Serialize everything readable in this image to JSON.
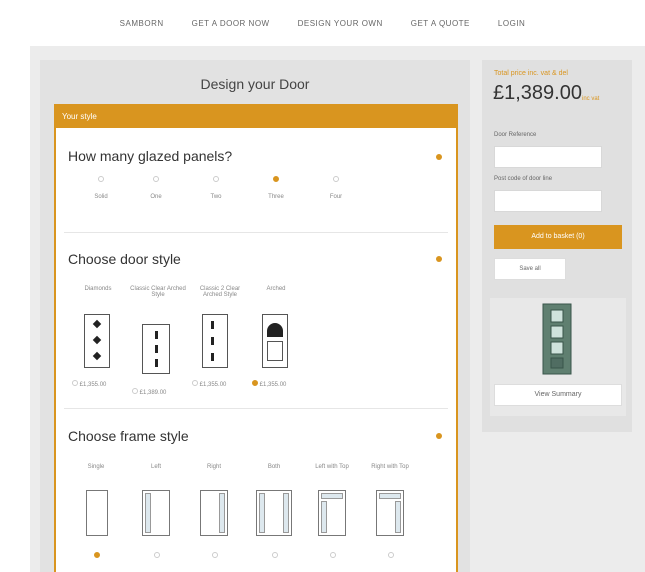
{
  "nav": {
    "items": [
      {
        "label": "SAMBORN"
      },
      {
        "label": "GET A DOOR NOW"
      },
      {
        "label": "DESIGN YOUR OWN"
      },
      {
        "label": "GET A QUOTE"
      },
      {
        "label": "LOGIN"
      }
    ]
  },
  "main": {
    "title": "Design your Door",
    "section_header": "Your style",
    "panels": {
      "title": "How many glazed panels?",
      "options": [
        {
          "label": "Solid",
          "selected": false
        },
        {
          "label": "One",
          "selected": false
        },
        {
          "label": "Two",
          "selected": false
        },
        {
          "label": "Three",
          "selected": true
        },
        {
          "label": "Four",
          "selected": false
        }
      ]
    },
    "door_style": {
      "title": "Choose door style",
      "options": [
        {
          "label": "Diamonds",
          "price": "£1,355.00",
          "selected": false
        },
        {
          "label": "Classic Clear Arched Style",
          "price": "£1,389.00",
          "selected": false
        },
        {
          "label": "Classic 2 Clear Arched Style",
          "price": "£1,355.00",
          "selected": false
        },
        {
          "label": "Arched",
          "price": "£1,355.00",
          "selected": true
        }
      ]
    },
    "frame_style": {
      "title": "Choose frame style",
      "options": [
        {
          "label": "Single",
          "selected": true
        },
        {
          "label": "Left",
          "selected": false
        },
        {
          "label": "Right",
          "selected": false
        },
        {
          "label": "Both",
          "selected": false
        },
        {
          "label": "Left with Top",
          "selected": false
        },
        {
          "label": "Right with Top",
          "selected": false
        }
      ]
    }
  },
  "sidebar": {
    "price_label": "Total price inc. vat & del",
    "price": "£1,389.00",
    "price_suffix": "inc vat",
    "ref_label": "Door Reference",
    "ref_value": "",
    "postcode_label": "Post code of door line",
    "postcode_value": "",
    "add_button": "Add to basket (0)",
    "save_button": "Save all",
    "summary_button": "View Summary"
  },
  "colors": {
    "accent": "#d9951f",
    "background": "#ececec"
  }
}
